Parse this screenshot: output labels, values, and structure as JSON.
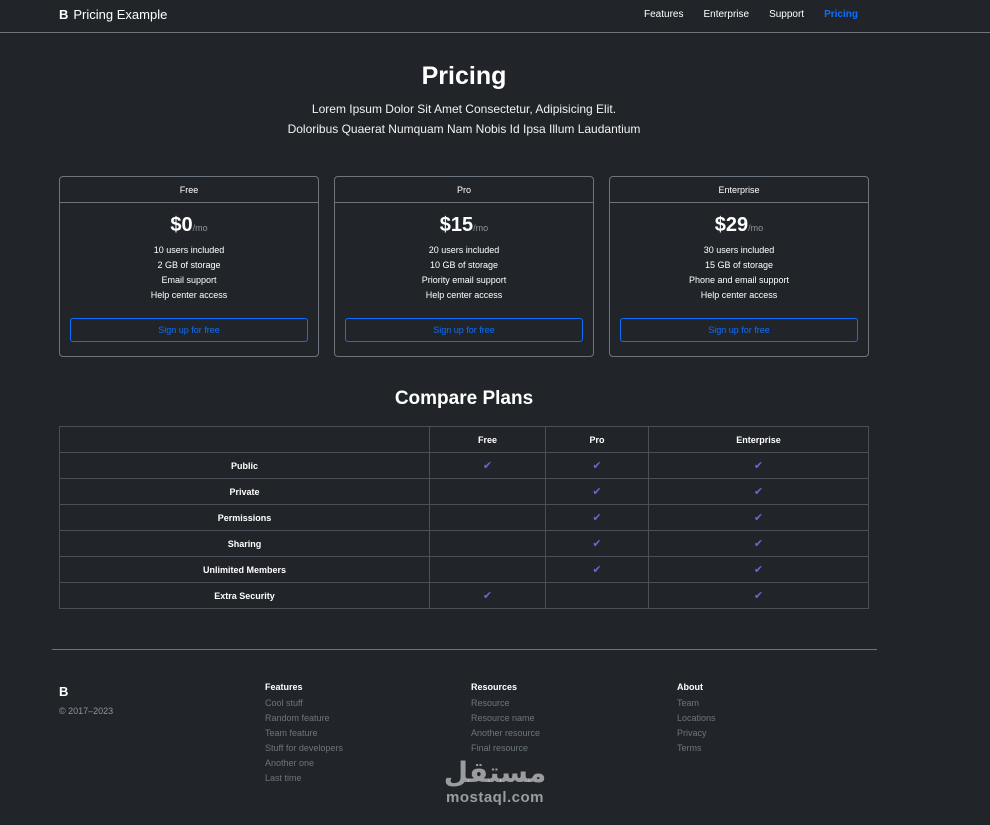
{
  "nav": {
    "brand_logo": "B",
    "brand_text": "Pricing Example",
    "links": [
      "Features",
      "Enterprise",
      "Support",
      "Pricing"
    ]
  },
  "hero": {
    "title": "Pricing",
    "line1": "Lorem Ipsum Dolor Sit Amet Consectetur, Adipisicing Elit.",
    "line2": "Doloribus Quaerat Numquam Nam Nobis Id Ipsa Illum Laudantium"
  },
  "plans": [
    {
      "name": "Free",
      "price": "$0",
      "per": "/mo",
      "features": [
        "10 users included",
        "2 GB of storage",
        "Email support",
        "Help center access"
      ],
      "button": "Sign up for free"
    },
    {
      "name": "Pro",
      "price": "$15",
      "per": "/mo",
      "features": [
        "20 users included",
        "10 GB of storage",
        "Priority email support",
        "Help center access"
      ],
      "button": "Sign up for free"
    },
    {
      "name": "Enterprise",
      "price": "$29",
      "per": "/mo",
      "features": [
        "30 users included",
        "15 GB of storage",
        "Phone and email support",
        "Help center access"
      ],
      "button": "Sign up for free"
    }
  ],
  "compare": {
    "title": "Compare Plans",
    "headers": [
      "",
      "Free",
      "Pro",
      "Enterprise"
    ],
    "rows": [
      {
        "label": "Public",
        "checks": [
          true,
          true,
          true
        ]
      },
      {
        "label": "Private",
        "checks": [
          false,
          true,
          true
        ]
      },
      {
        "label": "Permissions",
        "checks": [
          false,
          true,
          true
        ]
      },
      {
        "label": "Sharing",
        "checks": [
          false,
          true,
          true
        ]
      },
      {
        "label": "Unlimited Members",
        "checks": [
          false,
          true,
          true
        ]
      },
      {
        "label": "Extra Security",
        "checks": [
          true,
          false,
          true
        ]
      }
    ],
    "check_icon": "check-icon",
    "check_color": "#6f63d6"
  },
  "footer": {
    "brand": "B",
    "copyright": "© 2017–2023",
    "columns": [
      {
        "title": "Features",
        "items": [
          "Cool stuff",
          "Random feature",
          "Team feature",
          "Stuff for developers",
          "Another one",
          "Last time"
        ]
      },
      {
        "title": "Resources",
        "items": [
          "Resource",
          "Resource name",
          "Another resource",
          "Final resource"
        ]
      },
      {
        "title": "About",
        "items": [
          "Team",
          "Locations",
          "Privacy",
          "Terms"
        ]
      }
    ]
  },
  "watermark": {
    "arabic": "مستقل",
    "latin": "mostaql.com"
  },
  "colors": {
    "background": "#212529",
    "accent": "#0d6efd",
    "check": "#6f63d6"
  }
}
